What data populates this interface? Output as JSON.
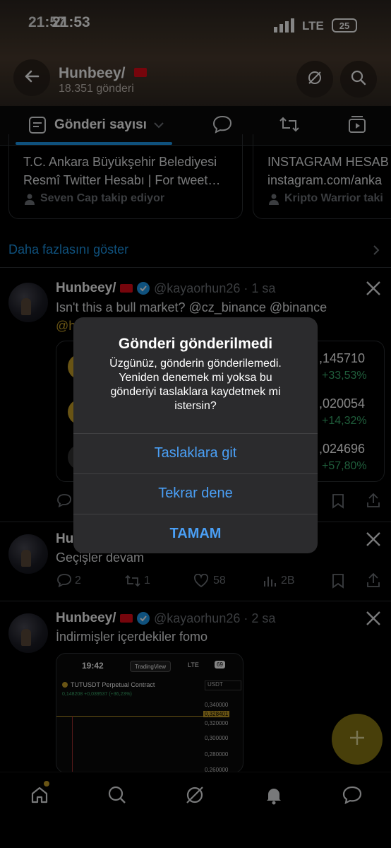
{
  "status": {
    "time_back": "21:57",
    "time_front": "21:53",
    "network": "LTE",
    "battery": "25"
  },
  "header": {
    "title": "Hunbeey/",
    "subtitle": "18.351 gönderi"
  },
  "tabs": {
    "active_label": "Gönderi sayısı"
  },
  "cards": [
    {
      "line1": "T.C. Ankara Büyükşehir Belediyesi",
      "line2": "Resmî Twitter Hesabı | For tweet…",
      "follower": "Seven Cap takip ediyor"
    },
    {
      "line1": "INSTAGRAM HESAB",
      "line2": "instagram.com/anka",
      "follower": "Kripto Warrior taki"
    }
  ],
  "show_more": "Daha fazlasını göster",
  "posts": [
    {
      "name": "Hunbeey/",
      "handle": "@kayaorhun26 · 1 sa",
      "text": "Isn't this a bull market? @cz_binance @binance",
      "text2": "@h",
      "prices": [
        {
          "value": ",145710",
          "change": "+33,53%"
        },
        {
          "value": ",020054",
          "change": "+14,32%"
        },
        {
          "value": ",024696",
          "change": "+57,80%"
        }
      ]
    },
    {
      "name": "Hu",
      "text": "Geçişler devam",
      "stats": {
        "replies": "2",
        "retweets": "1",
        "likes": "58",
        "views": "2B"
      }
    },
    {
      "name": "Hunbeey/",
      "handle": "@kayaorhun26 · 2 sa",
      "text": "İndirmişler içerdekiler fomo"
    }
  ],
  "embedded": {
    "time": "19:42",
    "app": "TradingView",
    "net": "LTE",
    "batt": "69",
    "pair": "TUTUSDT Perpetual Contract",
    "quote": "USDT",
    "price_line": "0,148208 +0,039537 (+36,23%)",
    "ticks": [
      "0,340000",
      "0,328401",
      "0,320000",
      "0,300000",
      "0,280000",
      "0,260000"
    ]
  },
  "dialog": {
    "title": "Gönderi gönderilmedi",
    "message": "Üzgünüz, gönderin gönderilemedi. Yeniden denemek mi yoksa bu gönderiyi taslaklara kaydetmek mi istersin?",
    "btn_drafts": "Taslaklara git",
    "btn_retry": "Tekrar dene",
    "btn_ok": "TAMAM"
  },
  "colors": {
    "accent": "#1d9bf0",
    "gold": "#c9a227",
    "green": "#3cb371",
    "dialog_link": "#4a9ff5"
  },
  "icons": [
    "back-arrow-icon",
    "explore-slash-icon",
    "search-icon",
    "list-icon",
    "chevron-down-icon",
    "comment-icon",
    "retweet-icon",
    "video-icon",
    "person-icon",
    "x-logo-icon",
    "verified-icon",
    "bookmark-icon",
    "share-icon",
    "heart-icon",
    "views-icon",
    "plus-icon",
    "home-icon",
    "grok-icon",
    "bell-icon",
    "messages-icon"
  ]
}
